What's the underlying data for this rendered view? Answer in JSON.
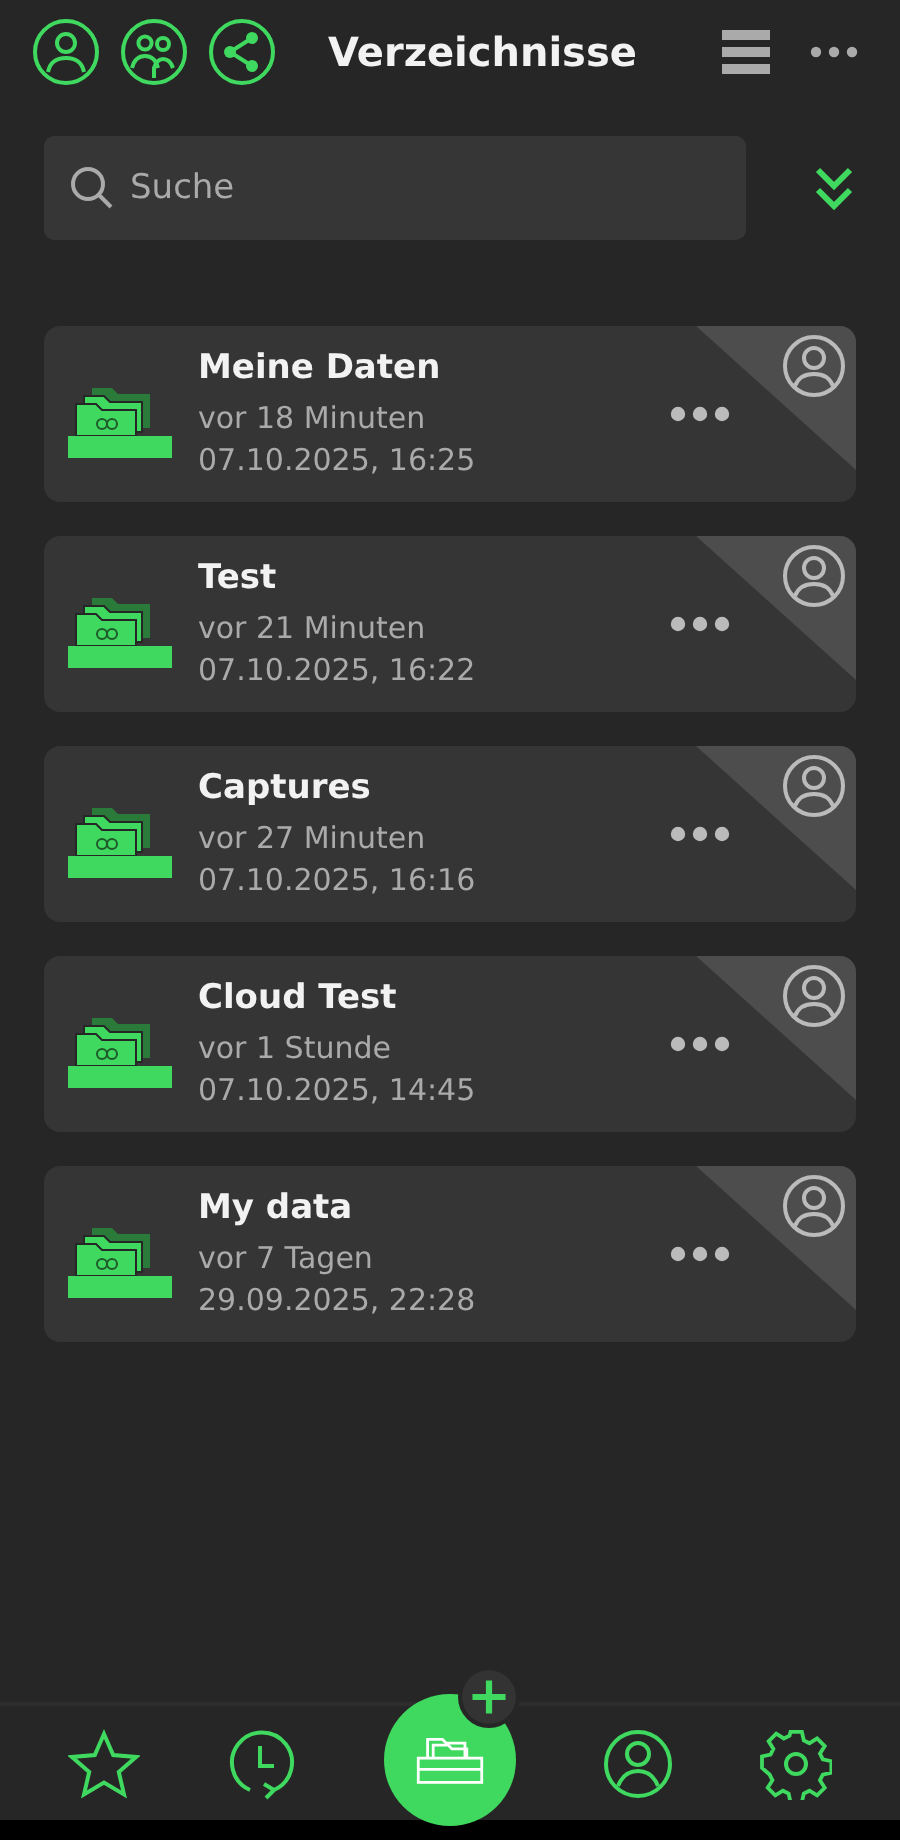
{
  "header": {
    "title": "Verzeichnisse"
  },
  "search": {
    "placeholder": "Suche"
  },
  "folders": [
    {
      "name": "Meine Daten",
      "age": "vor 18 Minuten",
      "date": "07.10.2025, 16:25"
    },
    {
      "name": "Test",
      "age": "vor 21 Minuten",
      "date": "07.10.2025, 16:22"
    },
    {
      "name": "Captures",
      "age": "vor 27 Minuten",
      "date": "07.10.2025, 16:16"
    },
    {
      "name": "Cloud Test",
      "age": "vor 1 Stunde",
      "date": "07.10.2025, 14:45"
    },
    {
      "name": "My data",
      "age": "vor 7 Tagen",
      "date": "29.09.2025, 22:28"
    }
  ]
}
